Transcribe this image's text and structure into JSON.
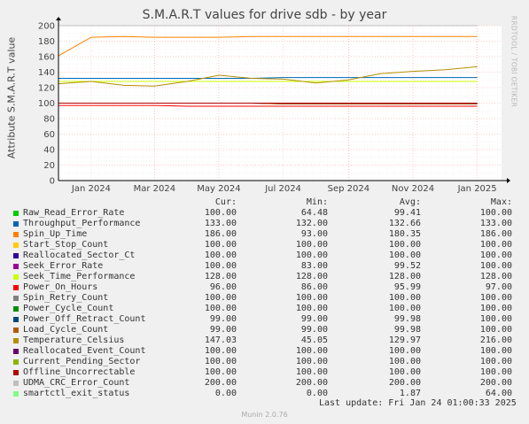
{
  "chart_data": {
    "type": "line",
    "title": "S.M.A.R.T values for drive sdb - by year",
    "ylabel": "Attribute S.M.A.R.T value",
    "watermark": "RRDTOOL / TOBI OETIKER",
    "ylim": [
      0,
      200
    ],
    "yticks": [
      0,
      20,
      40,
      60,
      80,
      100,
      120,
      140,
      160,
      180,
      200
    ],
    "x_ticks": [
      "Jan 2024",
      "Mar 2024",
      "May 2024",
      "Jul 2024",
      "Sep 2024",
      "Nov 2024",
      "Jan 2025"
    ],
    "grid": true,
    "x": [
      "2023-12",
      "2024-01",
      "2024-02",
      "2024-03",
      "2024-04",
      "2024-05",
      "2024-06",
      "2024-07",
      "2024-08",
      "2024-09",
      "2024-10",
      "2024-11",
      "2024-12",
      "2025-01"
    ],
    "columns": [
      "Cur:",
      "Min:",
      "Avg:",
      "Max:"
    ],
    "series": [
      {
        "name": "Raw_Read_Error_Rate",
        "color": "#00cc00",
        "cur": "100.00",
        "min": "64.48",
        "avg": "99.41",
        "max": "100.00",
        "values": [
          100,
          100,
          100,
          100,
          100,
          100,
          100,
          100,
          100,
          100,
          100,
          100,
          100,
          100
        ]
      },
      {
        "name": "Throughput_Performance",
        "color": "#0066b3",
        "cur": "133.00",
        "min": "132.00",
        "avg": "132.66",
        "max": "133.00",
        "values": [
          132,
          132,
          132,
          132,
          132,
          132,
          132,
          133,
          133,
          133,
          133,
          133,
          133,
          133
        ]
      },
      {
        "name": "Spin_Up_Time",
        "color": "#ff8000",
        "cur": "186.00",
        "min": "93.00",
        "avg": "180.35",
        "max": "186.00",
        "values": [
          161,
          185,
          186,
          185,
          185,
          185,
          186,
          186,
          186,
          186,
          186,
          186,
          186,
          186
        ]
      },
      {
        "name": "Start_Stop_Count",
        "color": "#ffcc00",
        "cur": "100.00",
        "min": "100.00",
        "avg": "100.00",
        "max": "100.00",
        "values": [
          100,
          100,
          100,
          100,
          100,
          100,
          100,
          100,
          100,
          100,
          100,
          100,
          100,
          100
        ]
      },
      {
        "name": "Reallocated_Sector_Ct",
        "color": "#330099",
        "cur": "100.00",
        "min": "100.00",
        "avg": "100.00",
        "max": "100.00",
        "values": [
          100,
          100,
          100,
          100,
          100,
          100,
          100,
          100,
          100,
          100,
          100,
          100,
          100,
          100
        ]
      },
      {
        "name": "Seek_Error_Rate",
        "color": "#990099",
        "cur": "100.00",
        "min": "83.00",
        "avg": "99.52",
        "max": "100.00",
        "values": [
          100,
          100,
          100,
          100,
          100,
          100,
          100,
          100,
          100,
          100,
          100,
          100,
          100,
          100
        ]
      },
      {
        "name": "Seek_Time_Performance",
        "color": "#ccff00",
        "cur": "128.00",
        "min": "128.00",
        "avg": "128.00",
        "max": "128.00",
        "values": [
          128,
          128,
          128,
          128,
          128,
          128,
          128,
          128,
          128,
          128,
          128,
          128,
          128,
          128
        ]
      },
      {
        "name": "Power_On_Hours",
        "color": "#ff0000",
        "cur": "96.00",
        "min": "86.00",
        "avg": "95.99",
        "max": "97.00",
        "values": [
          97,
          97,
          97,
          97,
          96,
          96,
          96,
          96,
          96,
          96,
          96,
          96,
          96,
          96
        ]
      },
      {
        "name": "Spin_Retry_Count",
        "color": "#808080",
        "cur": "100.00",
        "min": "100.00",
        "avg": "100.00",
        "max": "100.00",
        "values": [
          100,
          100,
          100,
          100,
          100,
          100,
          100,
          100,
          100,
          100,
          100,
          100,
          100,
          100
        ]
      },
      {
        "name": "Power_Cycle_Count",
        "color": "#008f00",
        "cur": "100.00",
        "min": "100.00",
        "avg": "100.00",
        "max": "100.00",
        "values": [
          100,
          100,
          100,
          100,
          100,
          100,
          100,
          100,
          100,
          100,
          100,
          100,
          100,
          100
        ]
      },
      {
        "name": "Power_Off_Retract_Count",
        "color": "#00487d",
        "cur": "99.00",
        "min": "99.00",
        "avg": "99.98",
        "max": "100.00",
        "values": [
          100,
          100,
          100,
          100,
          100,
          100,
          100,
          99,
          99,
          99,
          99,
          99,
          99,
          99
        ]
      },
      {
        "name": "Load_Cycle_Count",
        "color": "#b35a00",
        "cur": "99.00",
        "min": "99.00",
        "avg": "99.98",
        "max": "100.00",
        "values": [
          100,
          100,
          100,
          100,
          100,
          100,
          100,
          99,
          99,
          99,
          99,
          99,
          99,
          99
        ]
      },
      {
        "name": "Temperature_Celsius",
        "color": "#b38f00",
        "cur": "147.03",
        "min": "45.05",
        "avg": "129.97",
        "max": "216.00",
        "values": [
          125,
          128,
          123,
          122,
          128,
          136,
          132,
          131,
          126,
          130,
          138,
          141,
          143,
          147
        ]
      },
      {
        "name": "Reallocated_Event_Count",
        "color": "#6b006b",
        "cur": "100.00",
        "min": "100.00",
        "avg": "100.00",
        "max": "100.00",
        "values": [
          100,
          100,
          100,
          100,
          100,
          100,
          100,
          100,
          100,
          100,
          100,
          100,
          100,
          100
        ]
      },
      {
        "name": "Current_Pending_Sector",
        "color": "#8fb300",
        "cur": "100.00",
        "min": "100.00",
        "avg": "100.00",
        "max": "100.00",
        "values": [
          100,
          100,
          100,
          100,
          100,
          100,
          100,
          100,
          100,
          100,
          100,
          100,
          100,
          100
        ]
      },
      {
        "name": "Offline_Uncorrectable",
        "color": "#b30000",
        "cur": "100.00",
        "min": "100.00",
        "avg": "100.00",
        "max": "100.00",
        "values": [
          100,
          100,
          100,
          100,
          100,
          100,
          100,
          100,
          100,
          100,
          100,
          100,
          100,
          100
        ]
      },
      {
        "name": "UDMA_CRC_Error_Count",
        "color": "#bebebe",
        "cur": "200.00",
        "min": "200.00",
        "avg": "200.00",
        "max": "200.00",
        "values": [
          200,
          200,
          200,
          200,
          200,
          200,
          200,
          200,
          200,
          200,
          200,
          200,
          200,
          200
        ]
      },
      {
        "name": "smartctl_exit_status",
        "color": "#80ff80",
        "cur": "0.00",
        "min": "0.00",
        "avg": "1.87",
        "max": "64.00",
        "values": [
          0,
          0,
          0,
          0,
          0,
          0,
          0,
          0,
          0,
          0,
          0,
          0,
          0,
          0
        ]
      }
    ]
  },
  "footer": {
    "last_update": "Last update: Fri Jan 24 01:00:33 2025",
    "version": "Munin 2.0.76"
  }
}
